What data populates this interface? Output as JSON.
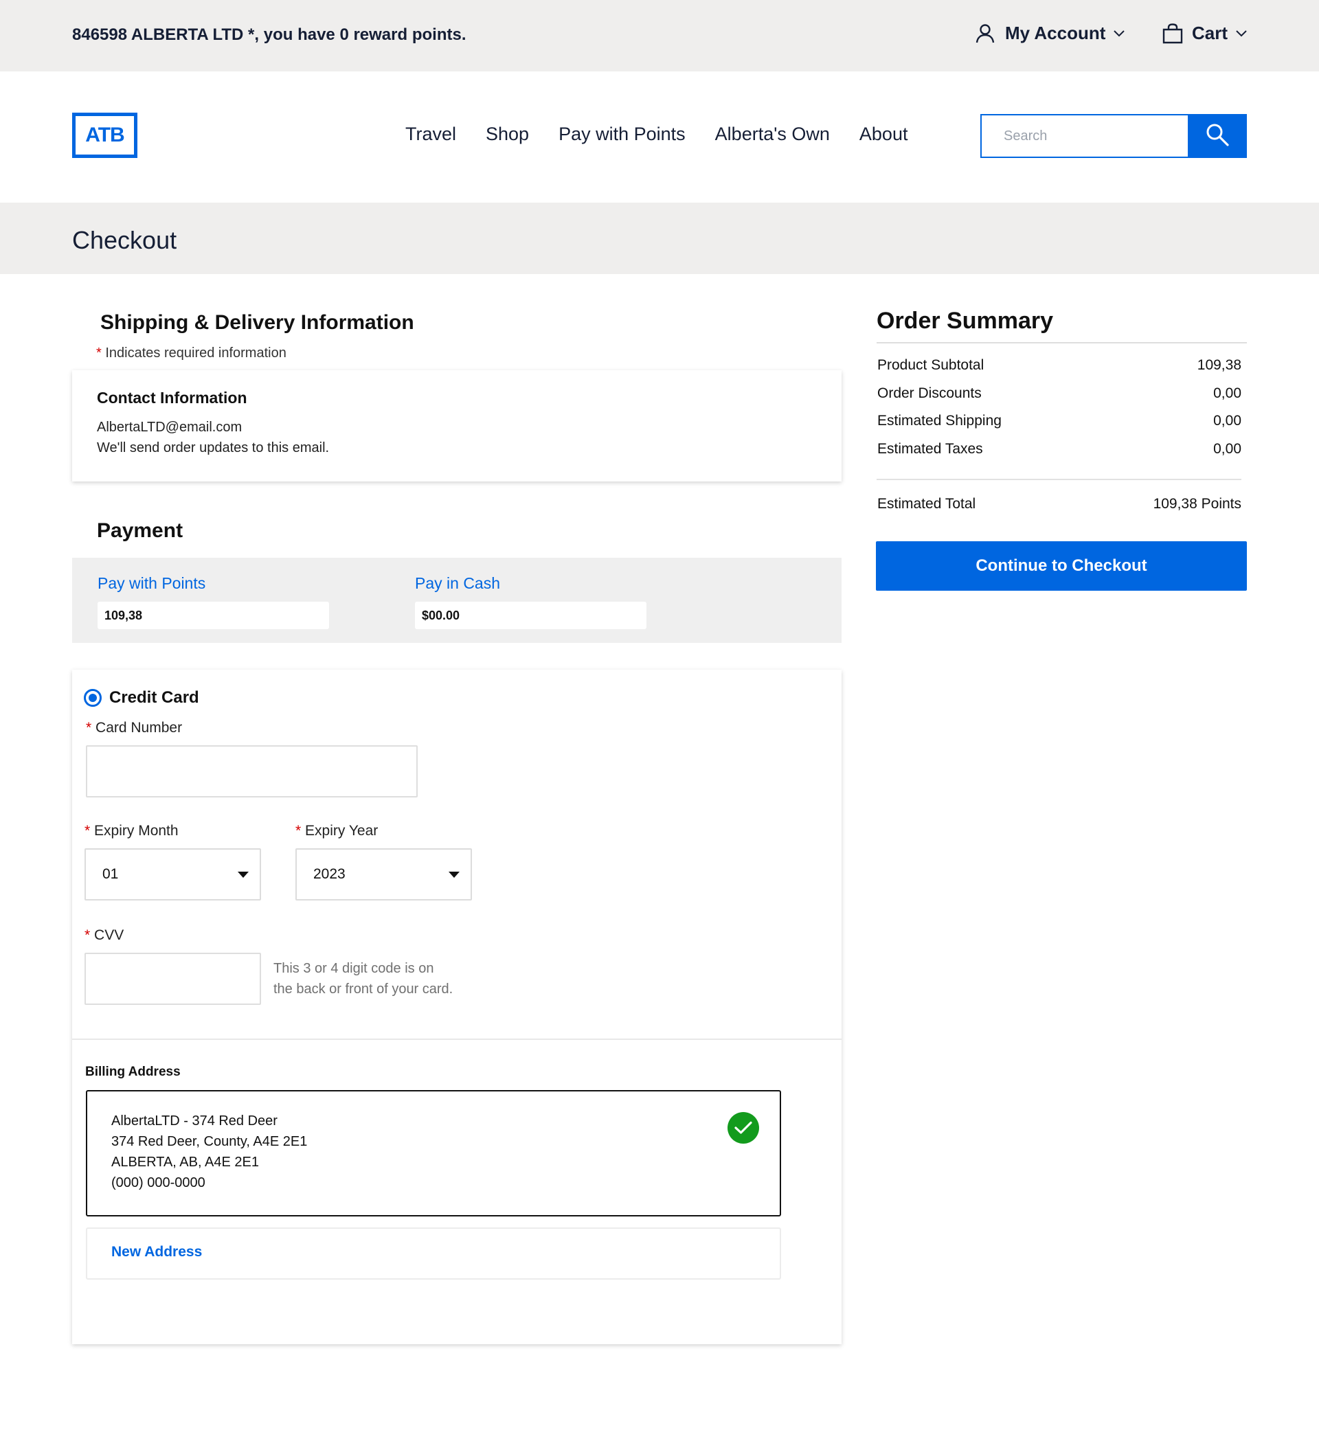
{
  "topbar": {
    "greeting": "846598 ALBERTA LTD *, you have 0 reward points.",
    "account_label": "My Account",
    "cart_label": "Cart"
  },
  "header": {
    "logo_text": "ATB",
    "nav": [
      "Travel",
      "Shop",
      "Pay with Points",
      "Alberta's Own",
      "About"
    ],
    "search_placeholder": "Search"
  },
  "page_title": "Checkout",
  "shipping": {
    "title": "Shipping & Delivery Information",
    "required_star": "*",
    "required_note": "Indicates required information",
    "contact_title": "Contact Information",
    "email": "AlbertaLTD@email.com",
    "email_note": "We'll send order updates to this email."
  },
  "payment": {
    "title": "Payment",
    "points_label": "Pay with Points",
    "points_value": "109,38",
    "cash_label": "Pay in Cash",
    "cash_value": "$00.00",
    "credit_card_label": "Credit Card",
    "card_number_label": "Card Number",
    "expiry_month_label": "Expiry Month",
    "expiry_month_value": "01",
    "expiry_year_label": "Expiry Year",
    "expiry_year_value": "2023",
    "cvv_label": "CVV",
    "cvv_help_1": "This 3 or 4 digit code is on",
    "cvv_help_2": "the back or front of your card."
  },
  "billing": {
    "title": "Billing Address",
    "address_lines": [
      "AlbertaLTD - 374 Red Deer",
      "374 Red Deer, County, A4E 2E1",
      "ALBERTA, AB, A4E 2E1",
      "(000) 000-0000"
    ],
    "new_address_label": "New Address"
  },
  "order_summary": {
    "title": "Order Summary",
    "rows": [
      {
        "label": "Product Subtotal",
        "value": "109,38"
      },
      {
        "label": "Order Discounts",
        "value": "0,00"
      },
      {
        "label": "Estimated Shipping",
        "value": "0,00"
      },
      {
        "label": "Estimated Taxes",
        "value": "0,00"
      }
    ],
    "total_label": "Estimated Total",
    "total_value": "109,38 Points",
    "cta_label": "Continue to Checkout"
  },
  "colors": {
    "brand_blue": "#0066e0",
    "band_gray": "#efeeed",
    "required_red": "#d40000",
    "success_green": "#139b1d"
  }
}
